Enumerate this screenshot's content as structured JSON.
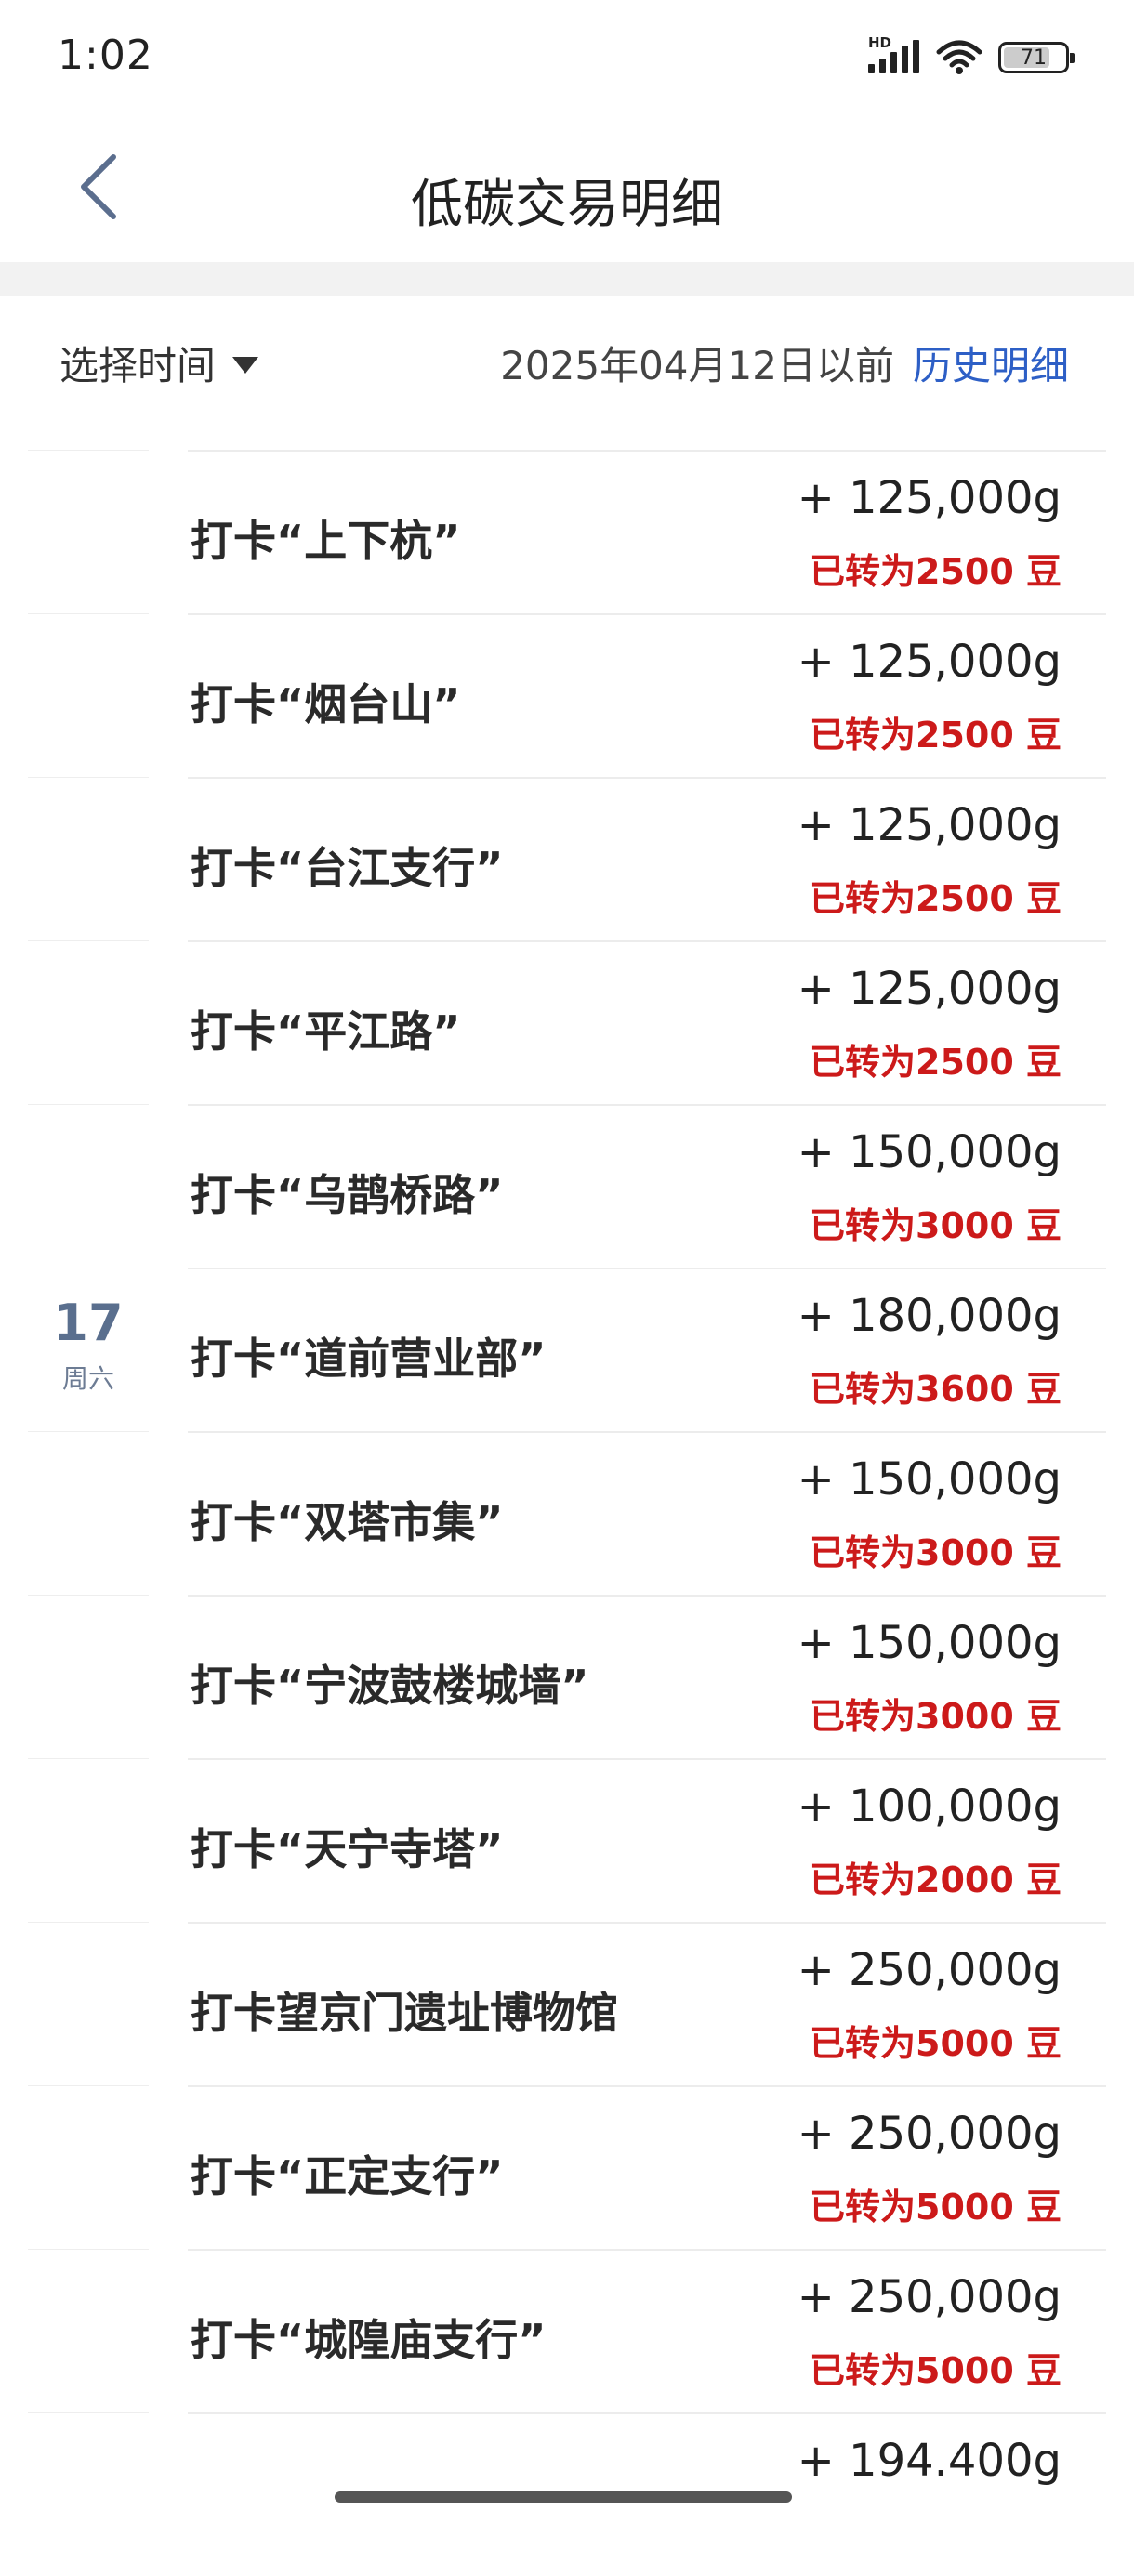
{
  "status_bar": {
    "time": "1:02",
    "signal_label": "HD",
    "battery": "71"
  },
  "nav": {
    "title": "低碳交易明细",
    "back_icon": "chevron-left-icon"
  },
  "filter": {
    "select_label": "选择时间",
    "before_text": "2025年04月12日以前",
    "history_label": "历史明细"
  },
  "colors": {
    "accent_blue": "#2d5fc6",
    "converted_red": "#cc1a1a",
    "day_label": "#5a6f8e"
  },
  "transactions": [
    {
      "name": "打卡“上下杭”",
      "amount": "+ 125,000g",
      "converted": "已转为2500 豆"
    },
    {
      "name": "打卡“烟台山”",
      "amount": "+ 125,000g",
      "converted": "已转为2500 豆"
    },
    {
      "name": "打卡“台江支行”",
      "amount": "+ 125,000g",
      "converted": "已转为2500 豆"
    },
    {
      "name": "打卡“平江路”",
      "amount": "+ 125,000g",
      "converted": "已转为2500 豆"
    },
    {
      "name": "打卡“乌鹊桥路”",
      "amount": "+ 150,000g",
      "converted": "已转为3000 豆"
    },
    {
      "name": "打卡“道前营业部”",
      "amount": "+ 180,000g",
      "converted": "已转为3600 豆",
      "day": "17",
      "weekday": "周六"
    },
    {
      "name": "打卡“双塔市集”",
      "amount": "+ 150,000g",
      "converted": "已转为3000 豆"
    },
    {
      "name": "打卡“宁波鼓楼城墙”",
      "amount": "+ 150,000g",
      "converted": "已转为3000 豆"
    },
    {
      "name": "打卡“天宁寺塔”",
      "amount": "+ 100,000g",
      "converted": "已转为2000 豆"
    },
    {
      "name": "打卡望京门遗址博物馆",
      "amount": "+ 250,000g",
      "converted": "已转为5000 豆"
    },
    {
      "name": "打卡“正定支行”",
      "amount": "+ 250,000g",
      "converted": "已转为5000 豆"
    },
    {
      "name": "打卡“城隍庙支行”",
      "amount": "+ 250,000g",
      "converted": "已转为5000 豆"
    },
    {
      "name": "",
      "amount": "+ 194.400g",
      "converted": ""
    }
  ]
}
